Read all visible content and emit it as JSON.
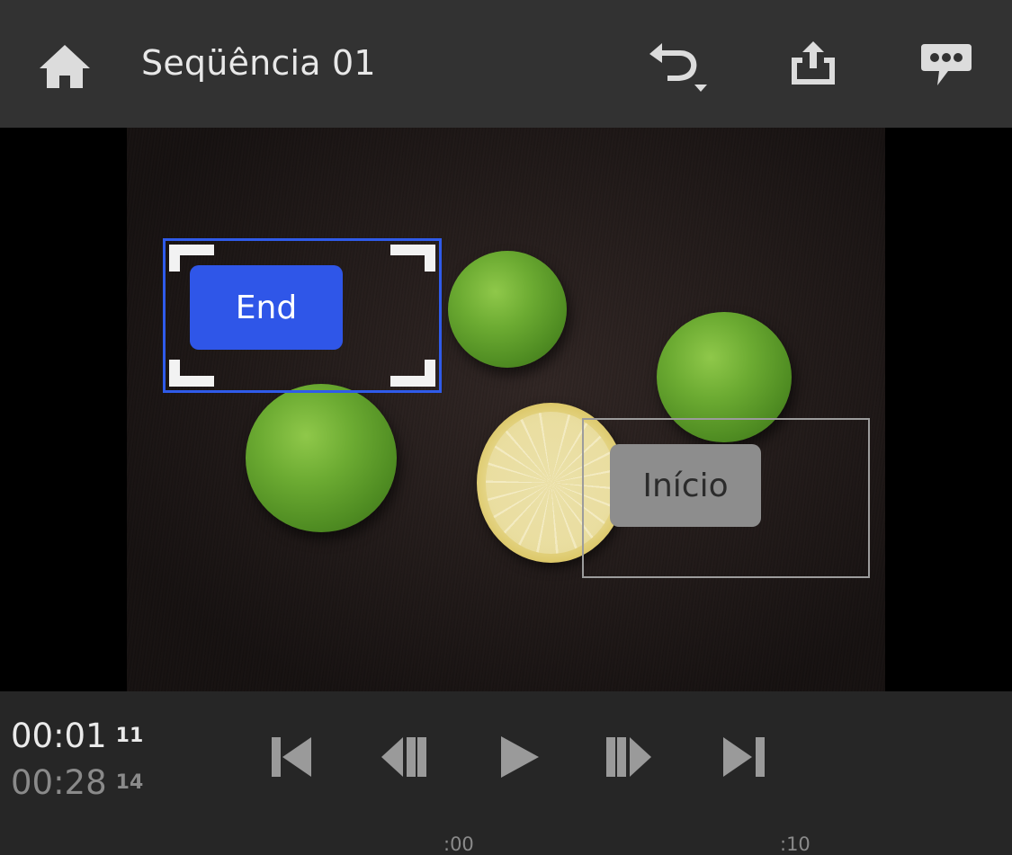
{
  "header": {
    "title": "Seqüência 01",
    "icons": {
      "home": "home-icon",
      "undo": "undo-icon",
      "share": "share-icon",
      "comments": "comments-icon"
    }
  },
  "viewer": {
    "titles": [
      {
        "label": "End",
        "state": "selected"
      },
      {
        "label": "Início",
        "state": "normal"
      }
    ],
    "colors": {
      "selection": "#2f5bea",
      "selected_label_bg": "#2f56e8",
      "inactive_label_bg": "#8d8d8d"
    }
  },
  "playback": {
    "current_time": "00:01",
    "current_frames": "11",
    "total_time": "00:28",
    "total_frames": "14",
    "buttons": [
      "go-to-start-icon",
      "step-back-icon",
      "play-icon",
      "step-forward-icon",
      "go-to-end-icon"
    ]
  },
  "timeline": {
    "ruler_labels": [
      ":00",
      ":10"
    ]
  }
}
